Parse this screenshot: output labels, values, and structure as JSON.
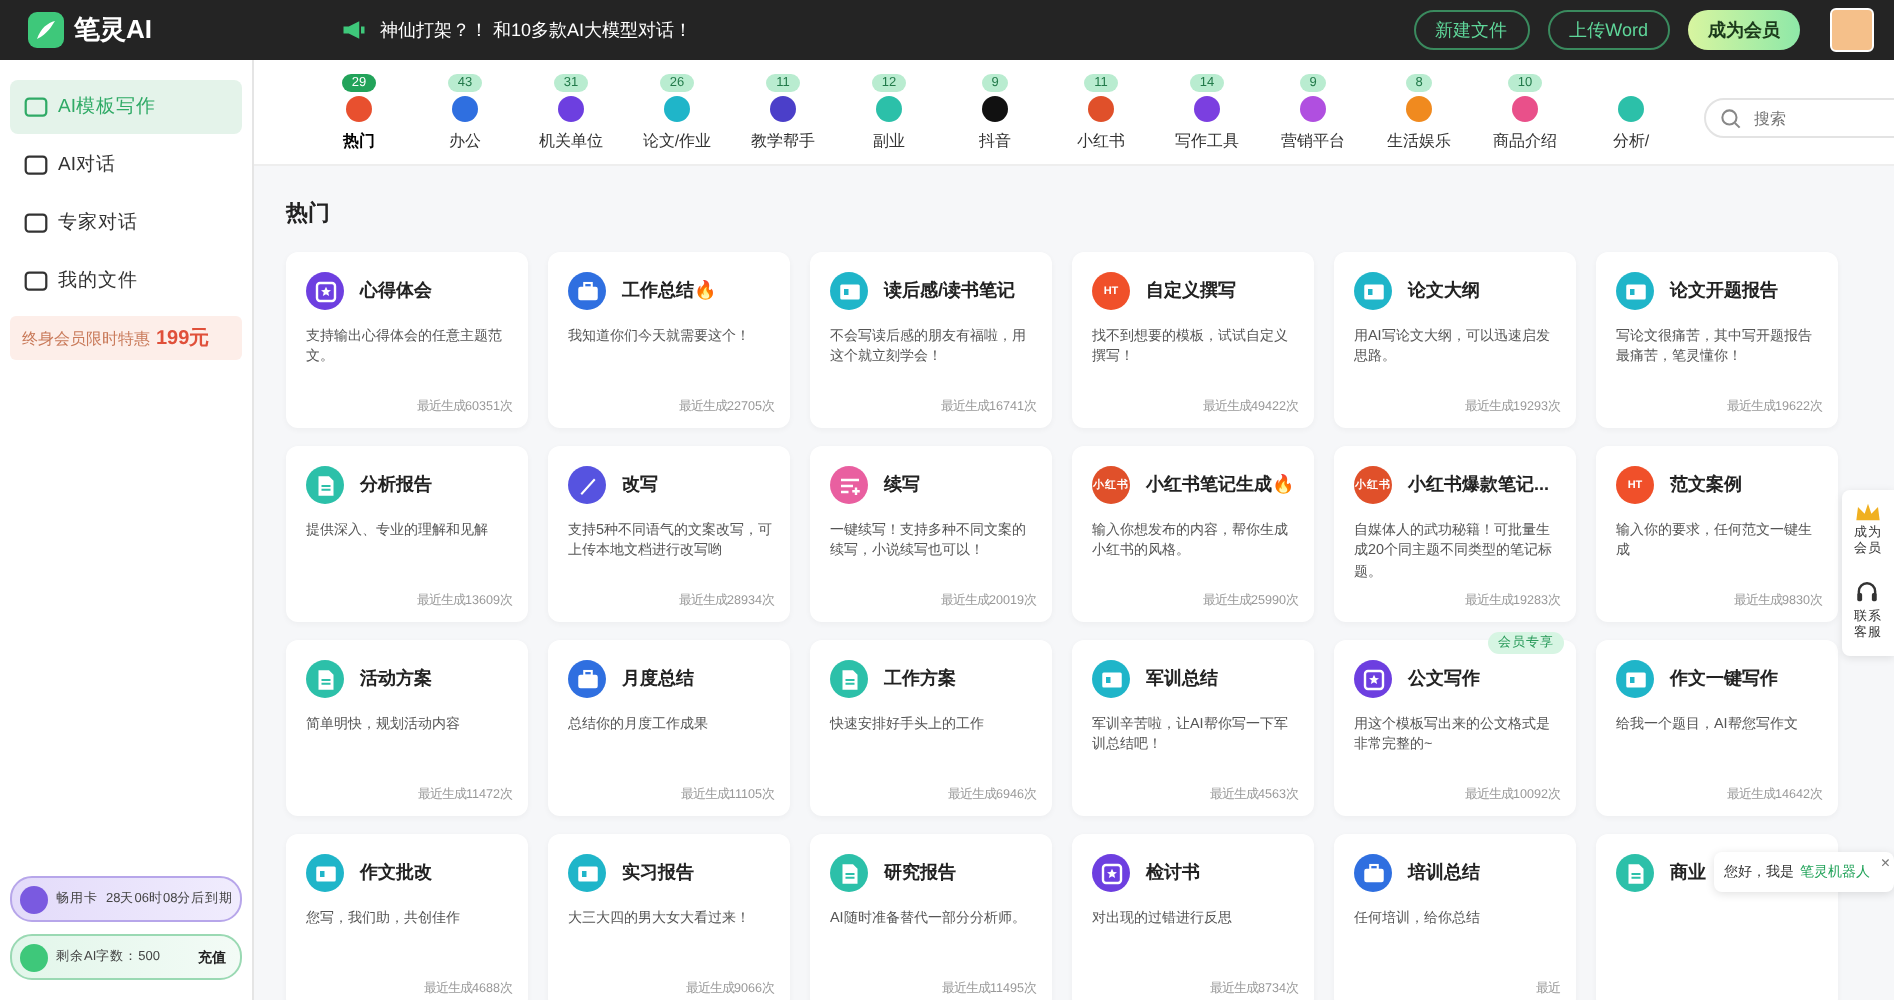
{
  "header": {
    "logo": "笔灵AI",
    "announcement": "神仙打架？！ 和10多款AI大模型对话！",
    "buttons": [
      {
        "label": "新建文件",
        "kind": "outline"
      },
      {
        "label": "上传Word",
        "kind": "outline"
      },
      {
        "label": "成为会员",
        "kind": "vip"
      }
    ]
  },
  "sidebar": {
    "items": [
      {
        "label": "AI模板写作",
        "selected": true
      },
      {
        "label": "AI对话",
        "selected": false
      },
      {
        "label": "专家对话",
        "selected": false
      },
      {
        "label": "我的文件",
        "selected": false
      }
    ],
    "promo": {
      "text": "终身会员限时特惠",
      "price": "199元"
    },
    "card_pass": {
      "name": "畅用卡",
      "expiry": "28天06时08分后到期"
    },
    "quota": {
      "text": "剩余AI字数：500",
      "action": "充值"
    }
  },
  "categories": [
    {
      "label": "热门",
      "count": "29",
      "color": "#e8502f",
      "selected": true
    },
    {
      "label": "办公",
      "count": "43",
      "color": "#2f6fe0",
      "selected": false
    },
    {
      "label": "机关单位",
      "count": "31",
      "color": "#6d3fe0",
      "selected": false
    },
    {
      "label": "论文/作业",
      "count": "26",
      "color": "#1fb5c9",
      "selected": false
    },
    {
      "label": "教学帮手",
      "count": "11",
      "color": "#4b3fc9",
      "selected": false
    },
    {
      "label": "副业",
      "count": "12",
      "color": "#2cc0a9",
      "selected": false
    },
    {
      "label": "抖音",
      "count": "9",
      "color": "#111111",
      "selected": false
    },
    {
      "label": "小红书",
      "count": "11",
      "color": "#e0502a",
      "selected": false
    },
    {
      "label": "写作工具",
      "count": "14",
      "color": "#7b3fe0",
      "selected": false
    },
    {
      "label": "营销平台",
      "count": "9",
      "color": "#b04fe0",
      "selected": false
    },
    {
      "label": "生活娱乐",
      "count": "8",
      "color": "#f08a1f",
      "selected": false
    },
    {
      "label": "商品介绍",
      "count": "10",
      "color": "#e9508a",
      "selected": false
    },
    {
      "label": "分析/",
      "color": "#2cc0a9",
      "selected": false
    }
  ],
  "search": {
    "placeholder": "搜索"
  },
  "section_title": "热门",
  "cards": [
    {
      "title": "心得体会",
      "desc": "支持输出心得体会的任意主题范文。",
      "count": "最近生成60351次",
      "kind": "star",
      "color": "#6d3fe0"
    },
    {
      "title": "工作总结🔥",
      "desc": "我知道你们今天就需要这个！",
      "count": "最近生成22705次",
      "kind": "briefcase",
      "color": "#2f6fe0"
    },
    {
      "title": "读后感/读书笔记",
      "desc": "不会写读后感的朋友有福啦，用这个就立刻学会！",
      "count": "最近生成16741次",
      "kind": "book",
      "color": "#1fb5c9"
    },
    {
      "title": "自定义撰写",
      "desc": "找不到想要的模板，试试自定义撰写！",
      "count": "最近生成49422次",
      "kind": "fire",
      "color": "#f0502a",
      "icon_text": "HT"
    },
    {
      "title": "论文大纲",
      "desc": "用AI写论文大纲，可以迅速启发思路。",
      "count": "最近生成19293次",
      "kind": "book",
      "color": "#1fb5c9"
    },
    {
      "title": "论文开题报告",
      "desc": "写论文很痛苦，其中写开题报告最痛苦，笔灵懂你！",
      "count": "最近生成19622次",
      "kind": "book",
      "color": "#1fb5c9"
    },
    {
      "title": "分析报告",
      "desc": "提供深入、专业的理解和见解",
      "count": "最近生成13609次",
      "kind": "doc",
      "color": "#2cc0a9"
    },
    {
      "title": "改写",
      "desc": "支持5种不同语气的文案改写，可上传本地文档进行改写哟",
      "count": "最近生成28934次",
      "kind": "pen",
      "color": "#5653e0"
    },
    {
      "title": "续写",
      "desc": "一键续写！支持多种不同文案的续写，小说续写也可以！",
      "count": "最近生成20019次",
      "kind": "edit",
      "color": "#e95fa0"
    },
    {
      "title": "小红书笔记生成🔥",
      "desc": "输入你想发布的内容，帮你生成小红书的风格。",
      "count": "最近生成25990次",
      "kind": "badge",
      "color": "#e0502a",
      "icon_text": "小红书"
    },
    {
      "title": "小红书爆款笔记...",
      "desc": "自媒体人的武功秘籍！可批量生成20个同主题不同类型的笔记标题。",
      "count": "最近生成19283次",
      "kind": "badge",
      "color": "#e0502a",
      "icon_text": "小红书"
    },
    {
      "title": "范文案例",
      "desc": "输入你的要求，任何范文一键生成",
      "count": "最近生成9830次",
      "kind": "fire",
      "color": "#f0502a",
      "icon_text": "HT"
    },
    {
      "title": "活动方案",
      "desc": "简单明快，规划活动内容",
      "count": "最近生成11472次",
      "kind": "doc",
      "color": "#2cc0a9"
    },
    {
      "title": "月度总结",
      "desc": "总结你的月度工作成果",
      "count": "最近生成11105次",
      "kind": "briefcase",
      "color": "#2f6fe0"
    },
    {
      "title": "工作方案",
      "desc": "快速安排好手头上的工作",
      "count": "最近生成6946次",
      "kind": "doc",
      "color": "#2cc0a9"
    },
    {
      "title": "军训总结",
      "desc": "军训辛苦啦，让AI帮你写一下军训总结吧！",
      "count": "最近生成4563次",
      "kind": "book",
      "color": "#1fb5c9"
    },
    {
      "title": "公文写作",
      "desc": "用这个模板写出来的公文格式是非常完整的~",
      "count": "最近生成10092次",
      "kind": "star",
      "color": "#6d3fe0",
      "tag": "会员专享"
    },
    {
      "title": "作文一键写作",
      "desc": "给我一个题目，AI帮您写作文",
      "count": "最近生成14642次",
      "kind": "book",
      "color": "#1fb5c9"
    },
    {
      "title": "作文批改",
      "desc": "您写，我们助，共创佳作",
      "count": "最近生成4688次",
      "kind": "book",
      "color": "#1fb5c9"
    },
    {
      "title": "实习报告",
      "desc": "大三大四的男大女大看过来！",
      "count": "最近生成9066次",
      "kind": "book",
      "color": "#1fb5c9"
    },
    {
      "title": "研究报告",
      "desc": "AI随时准备替代一部分分析师。",
      "count": "最近生成11495次",
      "kind": "doc",
      "color": "#2cc0a9"
    },
    {
      "title": "检讨书",
      "desc": "对出现的过错进行反思",
      "count": "最近生成8734次",
      "kind": "star",
      "color": "#6d3fe0"
    },
    {
      "title": "培训总结",
      "desc": "任何培训，给你总结",
      "count": "最近",
      "kind": "briefcase",
      "color": "#2f6fe0"
    },
    {
      "title": "商业",
      "kind": "doc",
      "color": "#2cc0a9"
    }
  ],
  "float_panel": [
    {
      "label": "成为会员",
      "kind": "crown"
    },
    {
      "label": "联系客服",
      "kind": "headset"
    }
  ],
  "chat_popup": {
    "text": "您好，我是",
    "name": "笔灵机器人",
    "close": "×"
  }
}
